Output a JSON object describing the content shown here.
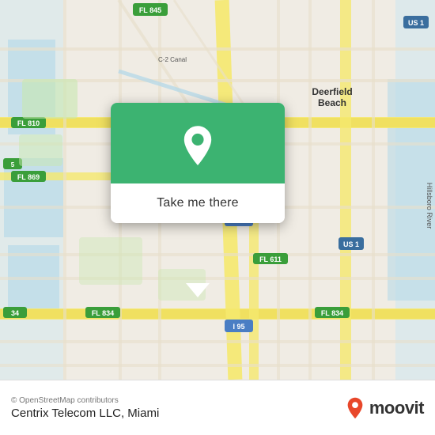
{
  "map": {
    "background_color": "#e8e0d8",
    "osm_credit": "© OpenStreetMap contributors",
    "center_lat": 26.27,
    "center_lng": -80.12
  },
  "popup": {
    "button_label": "Take me there",
    "pin_icon": "location-pin"
  },
  "bottom_bar": {
    "osm_credit": "© OpenStreetMap contributors",
    "location_name": "Centrix Telecom LLC, Miami",
    "moovit_label": "moovit"
  }
}
